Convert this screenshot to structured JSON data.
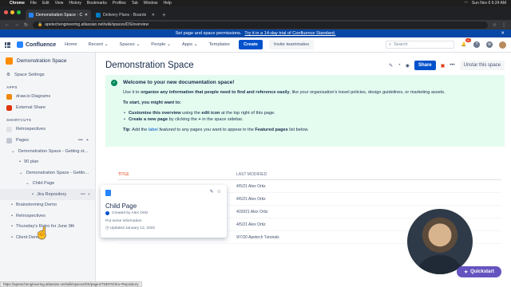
{
  "macbar": {
    "app": "Chrome",
    "menus": [
      "File",
      "Edit",
      "View",
      "History",
      "Bookmarks",
      "Profiles",
      "Tab",
      "Window",
      "Help"
    ],
    "clock": "Sun Nov 6 6:24 AM"
  },
  "browser": {
    "tabs": [
      {
        "title": "Demonstration Space - Conflu",
        "active": true
      },
      {
        "title": "Delivery Plans - Boards",
        "active": false
      }
    ],
    "url": "apetechengineering.atlassian.net/wiki/spaces/DS/overview",
    "status_url": "https://apetechengineering.atlassian.net/wiki/spaces/DS/pages/753676/Jira+Repository"
  },
  "banner": {
    "text": "Set page and space permissions.",
    "link": "Try it in a 14-day trial of Confluence Standard."
  },
  "topnav": {
    "product": "Confluence",
    "items": [
      "Home",
      "Recent",
      "Spaces",
      "People",
      "Apps",
      "Templates"
    ],
    "create": "Create",
    "invite": "Invite teammates",
    "search_placeholder": "Search",
    "notif_count": "9+"
  },
  "sidebar": {
    "space_name": "Demonstration Space",
    "space_settings": "Space Settings",
    "apps_header": "APPS",
    "apps": [
      "draw.io Diagrams",
      "External Share"
    ],
    "shortcuts_header": "SHORTCUTS",
    "shortcuts": [
      "Retrospectives"
    ],
    "pages_label": "Pages",
    "tree": [
      {
        "label": "Demonstration Space - Getting st...",
        "depth": 0
      },
      {
        "label": "90 plan",
        "depth": 1
      },
      {
        "label": "Demonstration Space - Gettin...",
        "depth": 1
      },
      {
        "label": "Child Page",
        "depth": 2
      },
      {
        "label": "Jira Repository",
        "depth": 3
      },
      {
        "label": "Brainstorming Demo",
        "depth": 0
      },
      {
        "label": "Retrospectives",
        "depth": 0
      },
      {
        "label": "Thursday's Retro for June 9th",
        "depth": 0
      },
      {
        "label": "Client Demo",
        "depth": 0
      }
    ]
  },
  "main": {
    "title": "Demonstration Space",
    "share": "Share",
    "unstar": "Unstar this space",
    "panel": {
      "heading": "Welcome to your new documentation space!",
      "intro_pre": "Use it to ",
      "intro_bold": "organize any information that people need to find and reference easily",
      "intro_post": ", like your organisation's travel policies, design guidelines, or marketing assets.",
      "start_heading": "To start, you might want to:",
      "b1_bold": "Customise this overview",
      "b1_mid": " using the ",
      "b1_bold2": "edit icon",
      "b1_post": " at the top right of this page.",
      "b2_bold": "Create a new page",
      "b2_mid": " by clicking the ",
      "b2_bold2": "+",
      "b2_post": " in the space sidebar.",
      "tip_bold": "Tip",
      "tip_pre": ": Add the ",
      "tip_link": "label",
      "tip_italic": "featured",
      "tip_mid": " to any pages you want to appear in the ",
      "tip_bold2": "Featured pages",
      "tip_post": " list below."
    },
    "table": {
      "col_title": "TITLE",
      "col_modified": "LAST MODIFIED",
      "rows": [
        {
          "modified": "4/5/21 Alex Ortiz"
        },
        {
          "modified": "4/5/21 Alex Ortiz"
        },
        {
          "modified": "4/30/21 Alex Ortiz"
        },
        {
          "modified": "4/5/21 Alex Ortiz"
        },
        {
          "modified": "9/7/20 Apetech Tutorials"
        }
      ]
    }
  },
  "hovercard": {
    "title": "Child Page",
    "created": "Created by Alex Ortiz",
    "excerpt": "Put some information",
    "updated": "Updated January 12, 2022"
  },
  "quickstart": "Quickstart",
  "colors": {
    "primary": "#0052cc",
    "banner": "#0747a6",
    "panel": "#e3fcef",
    "quickstart": "#6554c0"
  }
}
